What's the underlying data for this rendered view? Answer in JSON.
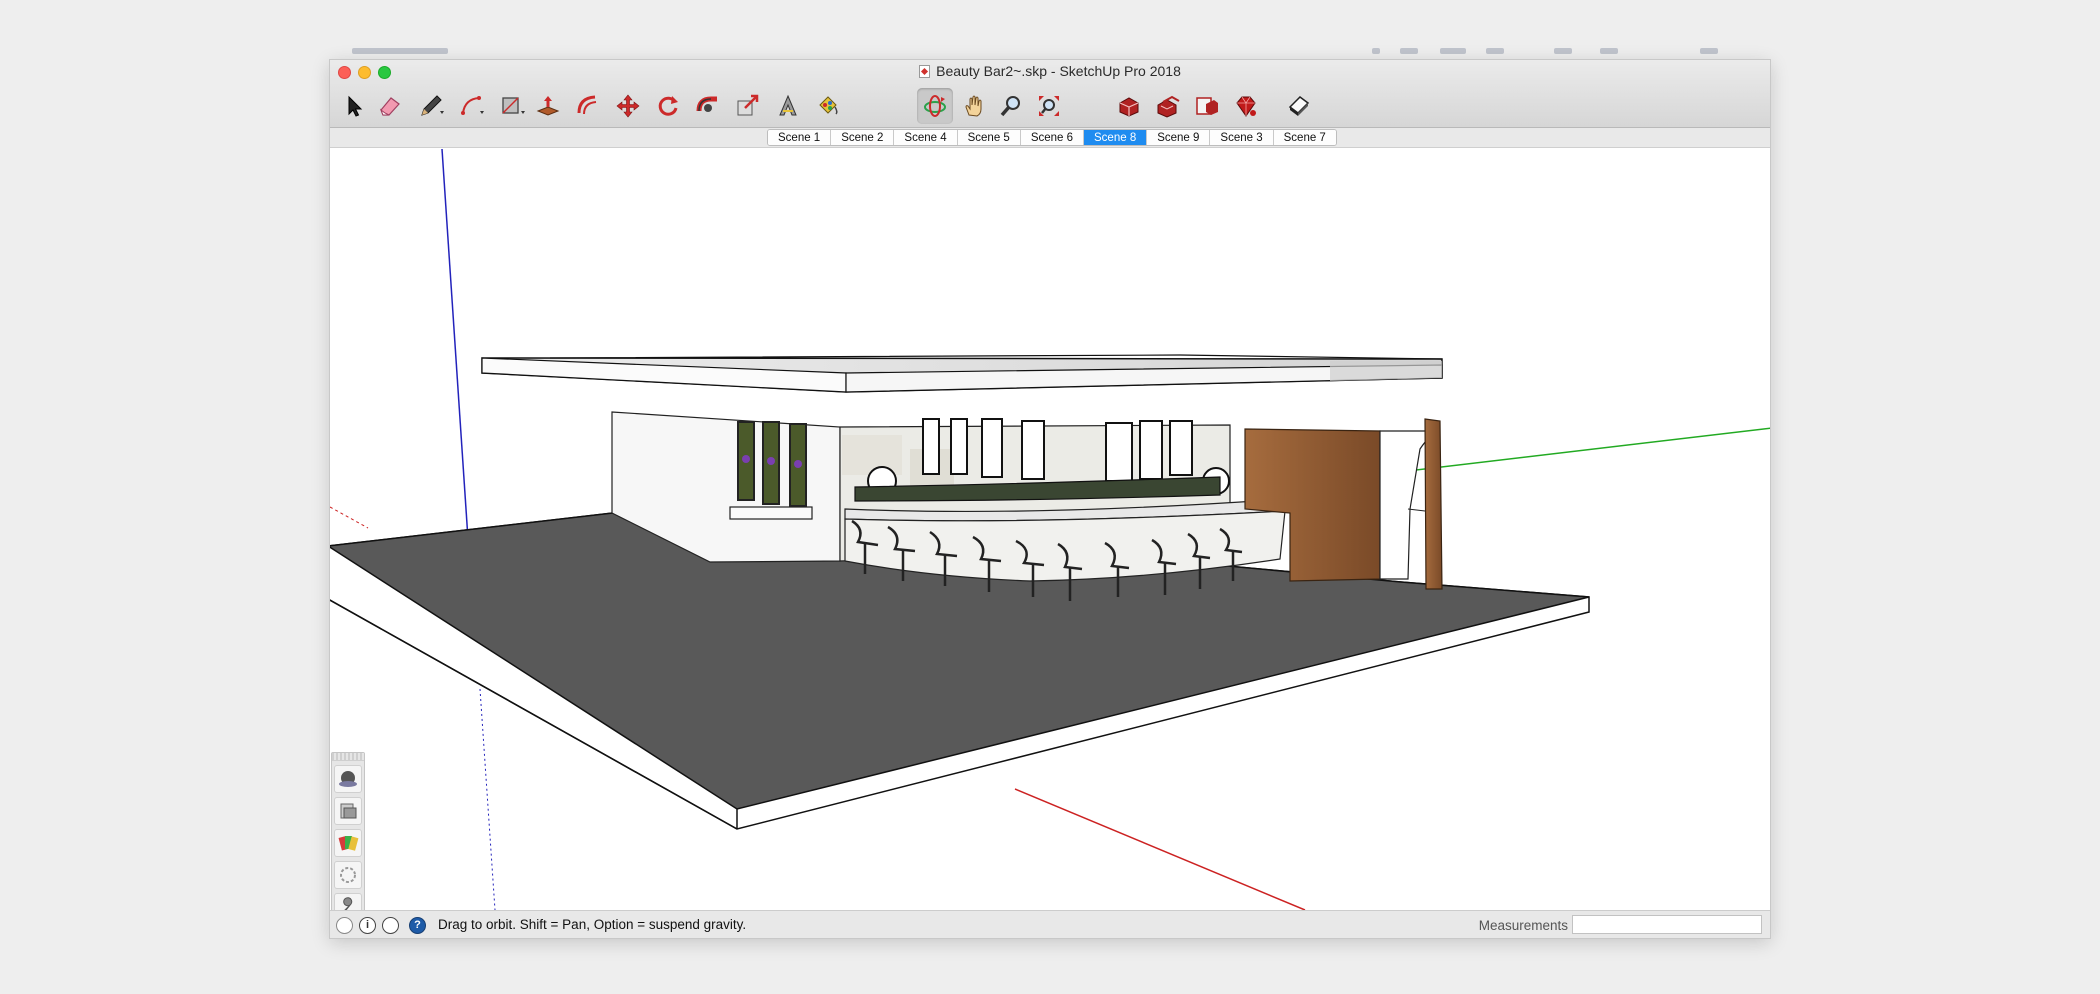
{
  "window": {
    "title": "Beauty Bar2~.skp - SketchUp Pro 2018"
  },
  "toolbar": {
    "tools": [
      {
        "name": "select-tool",
        "icon": "arrow-cursor-icon",
        "label": "Select"
      },
      {
        "name": "eraser-tool",
        "icon": "eraser-icon",
        "label": "Eraser"
      },
      {
        "name": "line-tool",
        "icon": "pencil-icon",
        "label": "Line"
      },
      {
        "name": "arc-tool",
        "icon": "arc-icon",
        "label": "Arc"
      },
      {
        "name": "shape-tool",
        "icon": "rectangle-icon",
        "label": "Shapes"
      },
      {
        "name": "pushpull-tool",
        "icon": "push-pull-icon",
        "label": "Push/Pull"
      },
      {
        "name": "offset-tool",
        "icon": "offset-icon",
        "label": "Offset"
      },
      {
        "name": "move-tool",
        "icon": "move-icon",
        "label": "Move"
      },
      {
        "name": "rotate-tool",
        "icon": "rotate-icon",
        "label": "Rotate"
      },
      {
        "name": "followme-tool",
        "icon": "follow-me-icon",
        "label": "Follow Me"
      },
      {
        "name": "scale-tool",
        "icon": "scale-icon",
        "label": "Scale"
      },
      {
        "name": "tape-tool",
        "icon": "tape-measure-icon",
        "label": "Tape Measure"
      },
      {
        "name": "paint-tool",
        "icon": "paint-bucket-icon",
        "label": "Paint Bucket"
      },
      {
        "name": "orbit-tool",
        "icon": "orbit-icon",
        "label": "Orbit",
        "active": true
      },
      {
        "name": "pan-tool",
        "icon": "hand-icon",
        "label": "Pan"
      },
      {
        "name": "zoom-tool",
        "icon": "magnifier-icon",
        "label": "Zoom"
      },
      {
        "name": "zoom-extents-tool",
        "icon": "zoom-extents-icon",
        "label": "Zoom Extents"
      },
      {
        "name": "warehouse-tool",
        "icon": "3d-warehouse-icon",
        "label": "3D Warehouse"
      },
      {
        "name": "share-model-tool",
        "icon": "share-model-icon",
        "label": "Share Model"
      },
      {
        "name": "extension-warehouse-tool",
        "icon": "extension-warehouse-icon",
        "label": "Extension Warehouse"
      },
      {
        "name": "ruby-console-tool",
        "icon": "ruby-icon",
        "label": "Ruby"
      },
      {
        "name": "layout-tool",
        "icon": "send-to-layout-icon",
        "label": "LayOut"
      }
    ]
  },
  "scenes": {
    "tabs": [
      "Scene 1",
      "Scene 2",
      "Scene 4",
      "Scene 5",
      "Scene 6",
      "Scene 8",
      "Scene 9",
      "Scene 3",
      "Scene 7"
    ],
    "selected": "Scene 8"
  },
  "palette": {
    "items": [
      "styles-icon",
      "components-icon",
      "materials-icon",
      "soften-edges-icon",
      "model-info-icon",
      "entity-info-icon",
      "shadows-icon"
    ]
  },
  "status": {
    "hint": "Drag to orbit. Shift = Pan, Option = suspend gravity.",
    "help_glyph": "?",
    "info_glyph": "i",
    "measurements_label": "Measurements",
    "measurements_value": ""
  },
  "colors": {
    "accent": "#1f8cf0",
    "axis_red": "#cc2222",
    "axis_green": "#22aa22",
    "axis_blue": "#2222bb",
    "ground": "#5a5a5a",
    "wood": "#8a5a36"
  }
}
